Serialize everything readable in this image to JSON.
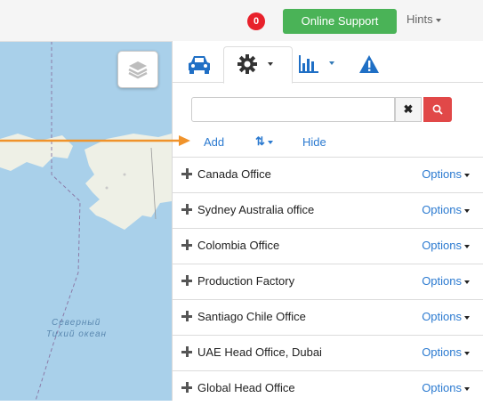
{
  "topbar": {
    "notification_count": "0",
    "support_label": "Online Support",
    "hints_label": "Hints"
  },
  "map": {
    "ocean_label_line1": "Северный",
    "ocean_label_line2": "Тихий океан"
  },
  "panel": {
    "tabs": [
      {
        "icon": "car-icon"
      },
      {
        "icon": "gear-icon",
        "active": true
      },
      {
        "icon": "bar-chart-icon"
      },
      {
        "icon": "warning-icon"
      }
    ],
    "search": {
      "value": "",
      "placeholder": ""
    },
    "actions": {
      "add_label": "Add",
      "sort_icon": "sort-icon",
      "hide_label": "Hide"
    },
    "options_label": "Options",
    "offices": [
      {
        "name": "Canada Office"
      },
      {
        "name": "Sydney Australia office"
      },
      {
        "name": "Colombia Office"
      },
      {
        "name": "Production Factory"
      },
      {
        "name": "Santiago Chile Office"
      },
      {
        "name": "UAE Head Office, Dubai"
      },
      {
        "name": "Global Head Office"
      }
    ]
  },
  "colors": {
    "accent_blue": "#2b7ad0",
    "support_green": "#4ab357",
    "badge_red": "#e8212b",
    "search_red": "#e14848",
    "annotation_orange": "#f0932b",
    "water": "#a9d0ea",
    "land": "#eef0e6"
  }
}
